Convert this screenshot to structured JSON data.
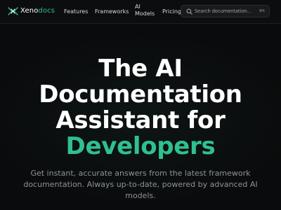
{
  "header": {
    "brand_part1": "Xeno",
    "brand_part2": "docs",
    "nav": {
      "features": "Features",
      "frameworks": "Frameworks",
      "ai_models_line1": "AI",
      "ai_models_line2": "Models",
      "pricing": "Pricing"
    },
    "search": {
      "placeholder": "Search documentation...",
      "shortcut": "⌘K"
    }
  },
  "hero": {
    "title_line1": "The AI",
    "title_line2": "Documentation",
    "title_line3": "Assistant for",
    "title_accent": "Developers",
    "subtitle": "Get instant, accurate answers from the latest framework documentation. Always up-to-date, powered by advanced AI models."
  },
  "colors": {
    "background": "#0a0b0c",
    "accent": "#2fc08f",
    "text": "#ffffff",
    "muted": "#8e9397"
  }
}
